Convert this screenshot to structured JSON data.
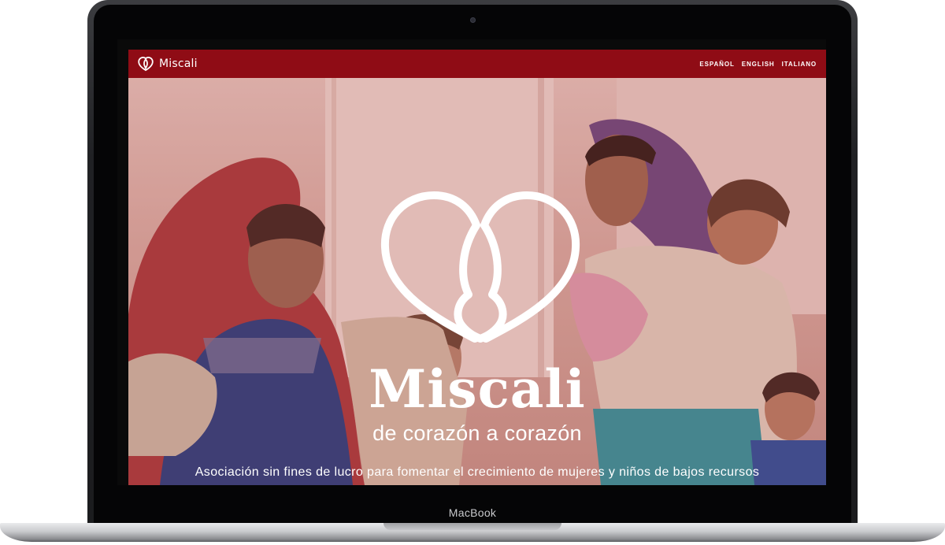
{
  "device": {
    "label": "MacBook"
  },
  "navbar": {
    "brand": "Miscali",
    "languages": [
      "ESPAÑOL",
      "ENGLISH",
      "ITALIANO"
    ]
  },
  "hero": {
    "title": "Miscali",
    "tagline": "de corazón a corazón",
    "description": "Asociación sin fines de lucro para fomentar el crecimiento de mujeres y niños de bajos recursos"
  },
  "colors": {
    "brand": "#8f0c15",
    "text_on_brand": "#ffffff"
  },
  "icons": {
    "logo": "double-heart-logo-icon"
  }
}
